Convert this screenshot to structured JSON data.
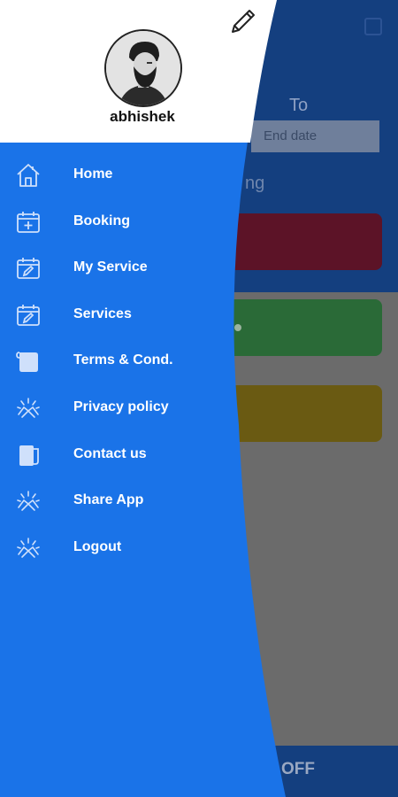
{
  "drawer": {
    "user": {
      "name": "abhishek"
    },
    "items": [
      {
        "label": "Home",
        "icon": "home-icon"
      },
      {
        "label": "Booking",
        "icon": "calendar-plus-icon"
      },
      {
        "label": "My Service",
        "icon": "calendar-edit-icon"
      },
      {
        "label": "Services",
        "icon": "calendar-edit-icon"
      },
      {
        "label": "Terms & Cond.",
        "icon": "scroll-icon"
      },
      {
        "label": "Privacy policy",
        "icon": "handshake-icon"
      },
      {
        "label": "Contact us",
        "icon": "document-icon"
      },
      {
        "label": "Share App",
        "icon": "handshake-icon"
      },
      {
        "label": "Logout",
        "icon": "handshake-icon"
      }
    ]
  },
  "background": {
    "to_label": "To",
    "end_date_placeholder": "End date",
    "partial_heading": "ng",
    "bottom_label": "OFF"
  },
  "colors": {
    "drawer_blue": "#1a73e8",
    "header_white": "#ffffff",
    "bg_navy": "#143f7f"
  }
}
